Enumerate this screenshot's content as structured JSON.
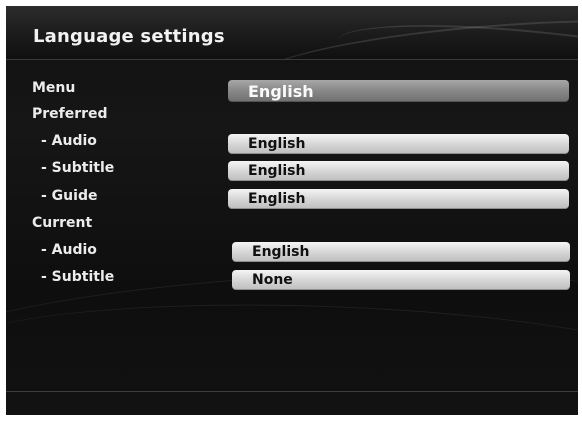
{
  "header": {
    "title": "Language settings"
  },
  "settings": {
    "menu": {
      "label": "Menu",
      "value": "English"
    },
    "preferred": {
      "label": "Preferred",
      "audio": {
        "label": "- Audio",
        "value": "English"
      },
      "subtitle": {
        "label": "- Subtitle",
        "value": "English"
      },
      "guide": {
        "label": "- Guide",
        "value": "English"
      }
    },
    "current": {
      "label": "Current",
      "audio": {
        "label": "- Audio",
        "value": "English"
      },
      "subtitle": {
        "label": "- Subtitle",
        "value": "None"
      }
    }
  }
}
